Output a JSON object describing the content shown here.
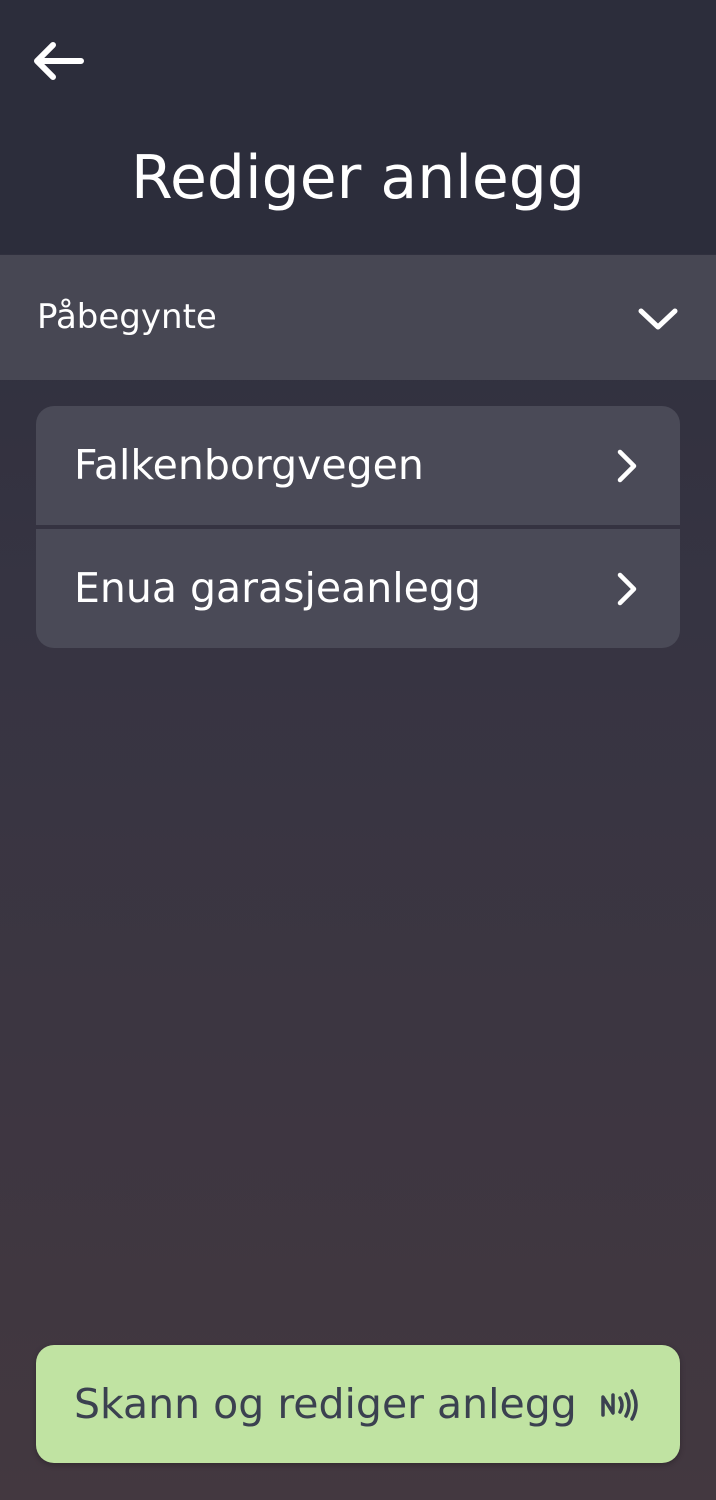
{
  "header": {
    "back_icon": "arrow-left-icon",
    "title": "Rediger anlegg"
  },
  "filter": {
    "selected": "Påbegynte",
    "icon": "chevron-down-icon"
  },
  "list": {
    "items": [
      {
        "label": "Falkenborgvegen",
        "icon": "chevron-right-icon"
      },
      {
        "label": "Enua garasjeanlegg",
        "icon": "chevron-right-icon"
      }
    ]
  },
  "scan_button": {
    "label": "Skann og rediger anlegg",
    "icon": "nfc-icon",
    "color": "#c0e3a2"
  }
}
